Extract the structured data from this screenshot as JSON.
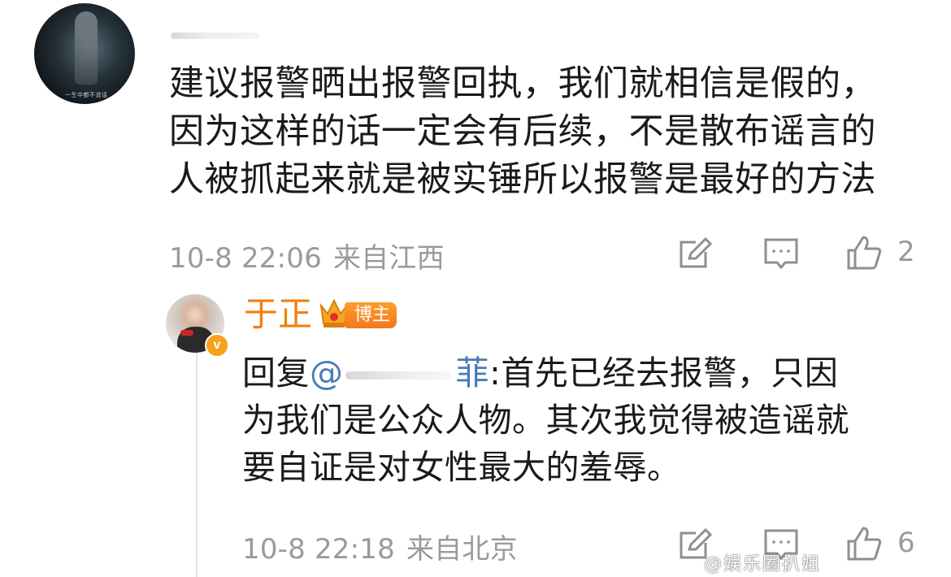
{
  "comment": {
    "lines": [
      "建议报警晒出报警回执，我们就相信是假的，",
      "因为这样的话一定会有后续，不是散布谣言的",
      "人被抓起来就是被实锤所以报警是最好的方法"
    ],
    "date": "10-8 22:06",
    "location": "来自江西",
    "like_count": "2",
    "avatar_caption": "一生中都不说话"
  },
  "reply": {
    "name": "于正",
    "badge": "博主",
    "verified_mark": "v",
    "prefix": "回复",
    "mention_at": "@",
    "mention_tail": "菲",
    "line1_rest": ":首先已经去报警，只因",
    "line2": "为我们是公众人物。其次我觉得被造谣就",
    "line3": "要自证是对女性最大的羞辱。",
    "date": "10-8 22:18",
    "location": "来自北京",
    "like_count": "6"
  },
  "watermark": "@娱乐圈扒姐",
  "colors": {
    "name_orange": "#f07f12",
    "mention_blue": "#4a7bb8",
    "meta_gray": "#9a9a9a",
    "badge_orange": "#f7a21b"
  },
  "icons": [
    "edit-icon",
    "comment-icon",
    "like-icon",
    "crown-icon",
    "verified-icon"
  ]
}
